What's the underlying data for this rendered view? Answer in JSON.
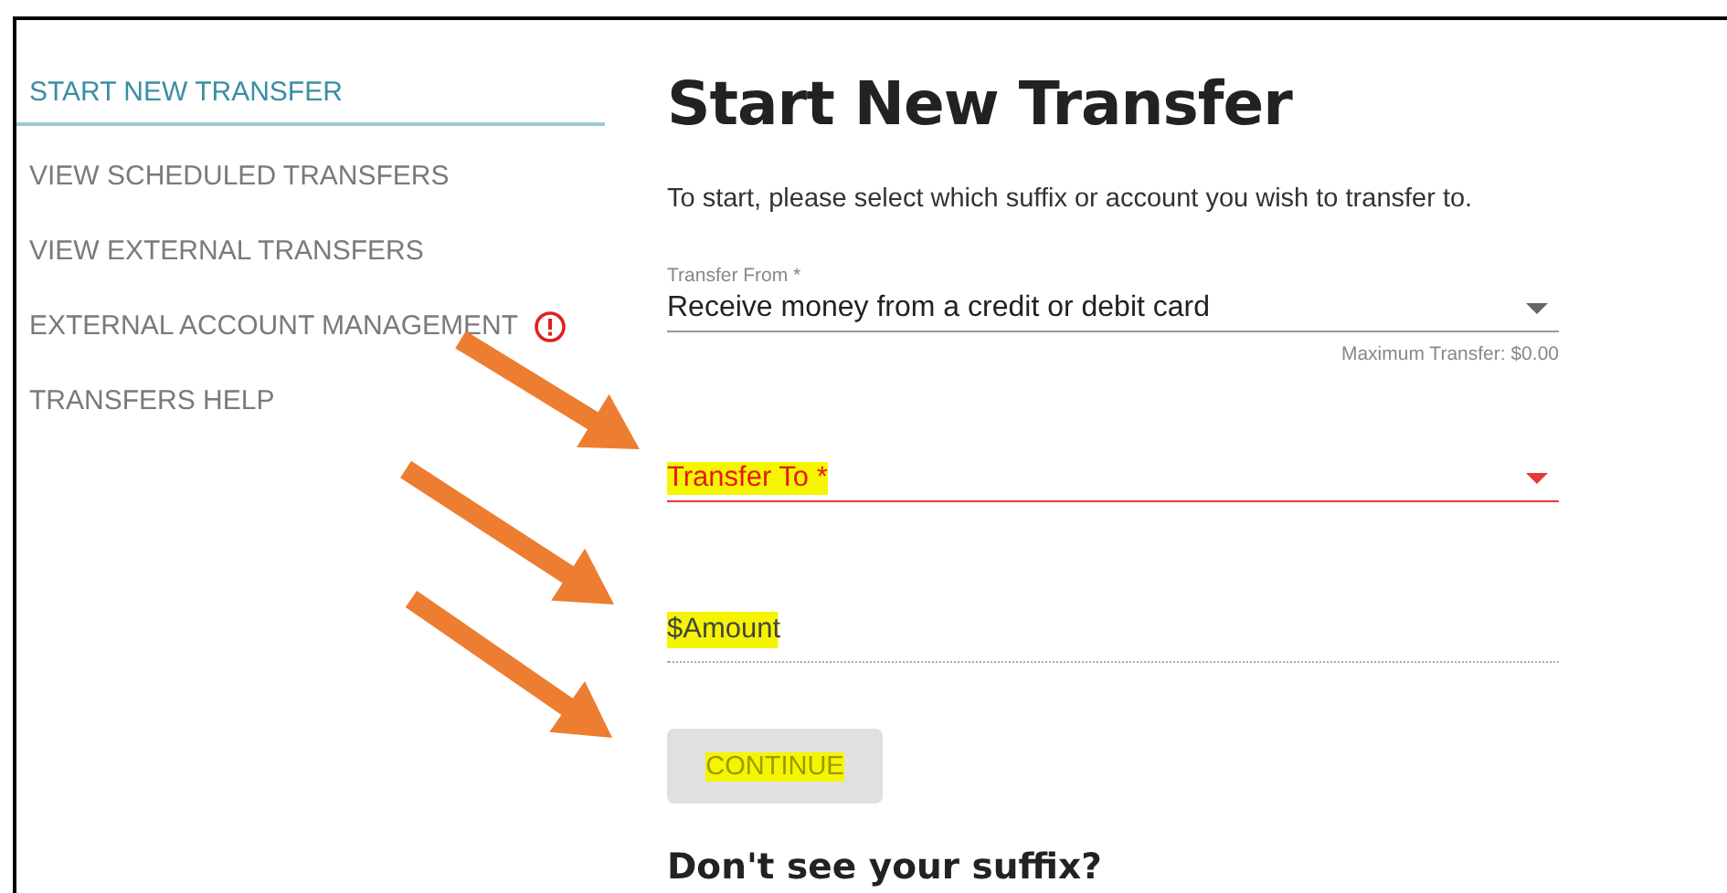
{
  "sidebar": {
    "items": [
      {
        "label": "START NEW TRANSFER",
        "selected": true,
        "alert": false
      },
      {
        "label": "VIEW SCHEDULED TRANSFERS",
        "selected": false,
        "alert": false
      },
      {
        "label": "VIEW EXTERNAL TRANSFERS",
        "selected": false,
        "alert": false
      },
      {
        "label": "EXTERNAL ACCOUNT MANAGEMENT",
        "selected": false,
        "alert": true
      },
      {
        "label": "TRANSFERS HELP",
        "selected": false,
        "alert": false
      }
    ]
  },
  "title": "Start New Transfer",
  "intro": "To start, please select which suffix or account you wish to transfer to.",
  "form": {
    "fields": [
      {
        "kind": "select",
        "label": "Transfer From *",
        "value": "Receive money from a credit or debit card",
        "helper": "Maximum Transfer: $0.00",
        "error": false
      },
      {
        "kind": "select",
        "placeholder": "Transfer To *",
        "error": true,
        "highlighted": true
      },
      {
        "kind": "text",
        "placeholder": "$Amount",
        "error": false,
        "highlighted": true
      }
    ],
    "button": {
      "label": "CONTINUE",
      "disabled": true,
      "highlighted": true
    }
  },
  "subheading": "Don't see your suffix?",
  "annotations": [
    {
      "kind": "arrow"
    },
    {
      "kind": "arrow"
    },
    {
      "kind": "arrow"
    }
  ]
}
